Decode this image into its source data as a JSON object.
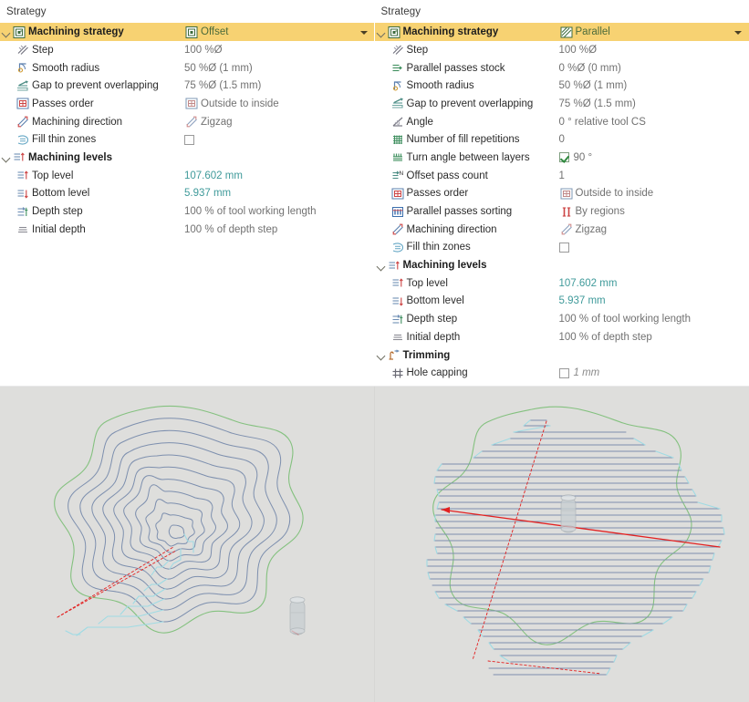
{
  "left_panel": {
    "title": "Strategy",
    "rows": [
      {
        "level": 0,
        "expander": "expanded",
        "icon": "machining-strategy-icon",
        "label": "Machining strategy",
        "value": "Offset",
        "value_icon": "offset-icon",
        "header": true,
        "dropdown": true
      },
      {
        "level": 1,
        "icon": "step-icon",
        "label": "Step",
        "value": "100 %Ø"
      },
      {
        "level": 1,
        "icon": "smooth-radius-icon",
        "label": "Smooth radius",
        "value": "50 %Ø (1 mm)"
      },
      {
        "level": 1,
        "icon": "gap-overlap-icon",
        "label": "Gap to prevent overlapping",
        "value": "75 %Ø (1.5 mm)"
      },
      {
        "level": 1,
        "icon": "passes-order-icon",
        "label": "Passes order",
        "value": "Outside to inside",
        "value_icon": "outside-to-inside-icon"
      },
      {
        "level": 1,
        "icon": "machining-direction-icon",
        "label": "Machining direction",
        "value": "Zigzag",
        "value_icon": "zigzag-icon"
      },
      {
        "level": 1,
        "icon": "fill-thin-zones-icon",
        "label": "Fill thin zones",
        "value": "",
        "checkbox": "unchecked"
      },
      {
        "level": 0,
        "expander": "expanded",
        "icon": "machining-levels-icon",
        "label": "Machining levels",
        "value": "",
        "group": true
      },
      {
        "level": 1,
        "icon": "top-level-icon",
        "label": "Top level",
        "value": "107.602 mm",
        "value_color": "teal"
      },
      {
        "level": 1,
        "icon": "bottom-level-icon",
        "label": "Bottom level",
        "value": "5.937 mm",
        "value_color": "teal"
      },
      {
        "level": 1,
        "icon": "depth-step-icon",
        "label": "Depth step",
        "value": "100 % of tool working length"
      },
      {
        "level": 1,
        "icon": "initial-depth-icon",
        "label": "Initial depth",
        "value": "100 % of depth step"
      }
    ]
  },
  "right_panel": {
    "title": "Strategy",
    "rows": [
      {
        "level": 0,
        "expander": "expanded",
        "icon": "machining-strategy-icon",
        "label": "Machining strategy",
        "value": "Parallel",
        "value_icon": "parallel-icon",
        "header": true,
        "dropdown": true
      },
      {
        "level": 1,
        "icon": "step-icon",
        "label": "Step",
        "value": "100 %Ø"
      },
      {
        "level": 1,
        "icon": "parallel-passes-stock-icon",
        "label": "Parallel passes stock",
        "value": "0 %Ø (0 mm)"
      },
      {
        "level": 1,
        "icon": "smooth-radius-icon",
        "label": "Smooth radius",
        "value": "50 %Ø (1 mm)"
      },
      {
        "level": 1,
        "icon": "gap-overlap-icon",
        "label": "Gap to prevent overlapping",
        "value": "75 %Ø (1.5 mm)"
      },
      {
        "level": 1,
        "icon": "angle-icon",
        "label": "Angle",
        "value": "0 ° relative tool CS"
      },
      {
        "level": 1,
        "icon": "fill-repetitions-icon",
        "label": "Number of fill repetitions",
        "value": "0"
      },
      {
        "level": 1,
        "icon": "turn-angle-icon",
        "label": "Turn angle between layers",
        "value": "90 °",
        "checkbox": "checked"
      },
      {
        "level": 1,
        "icon": "offset-pass-count-icon",
        "label": "Offset pass count",
        "value": "1"
      },
      {
        "level": 1,
        "icon": "passes-order-icon",
        "label": "Passes order",
        "value": "Outside to inside",
        "value_icon": "outside-to-inside-icon"
      },
      {
        "level": 1,
        "icon": "parallel-passes-sorting-icon",
        "label": "Parallel passes sorting",
        "value": "By regions",
        "value_icon": "by-regions-icon"
      },
      {
        "level": 1,
        "icon": "machining-direction-icon",
        "label": "Machining direction",
        "value": "Zigzag",
        "value_icon": "zigzag-icon"
      },
      {
        "level": 1,
        "icon": "fill-thin-zones-icon",
        "label": "Fill thin zones",
        "value": "",
        "checkbox": "unchecked"
      },
      {
        "level": 0,
        "expander": "expanded",
        "icon": "machining-levels-icon",
        "label": "Machining levels",
        "value": "",
        "group": true
      },
      {
        "level": 1,
        "icon": "top-level-icon",
        "label": "Top level",
        "value": "107.602 mm",
        "value_color": "teal"
      },
      {
        "level": 1,
        "icon": "bottom-level-icon",
        "label": "Bottom level",
        "value": "5.937 mm",
        "value_color": "teal"
      },
      {
        "level": 1,
        "icon": "depth-step-icon",
        "label": "Depth step",
        "value": "100 % of tool working length"
      },
      {
        "level": 1,
        "icon": "initial-depth-icon",
        "label": "Initial depth",
        "value": "100 % of depth step"
      },
      {
        "level": 0,
        "expander": "expanded",
        "icon": "trimming-icon",
        "label": "Trimming",
        "value": "",
        "group": true
      },
      {
        "level": 1,
        "icon": "hole-capping-icon",
        "label": "Hole capping",
        "value": "1 mm",
        "checkbox": "unchecked",
        "value_color": "italic"
      }
    ]
  },
  "viewports": {
    "left": {
      "name": "offset-toolpath-preview",
      "strategy": "Offset"
    },
    "right": {
      "name": "parallel-toolpath-preview",
      "strategy": "Parallel"
    }
  },
  "colors": {
    "header_highlight": "#f7d272",
    "stock_outline": "#84c17f",
    "toolpath": "#7d8fae",
    "lead_in": "#9fdbe4",
    "rapid_move": "#e32020",
    "viewport_bg": "#dededc",
    "value_teal": "#3f9a9a"
  }
}
